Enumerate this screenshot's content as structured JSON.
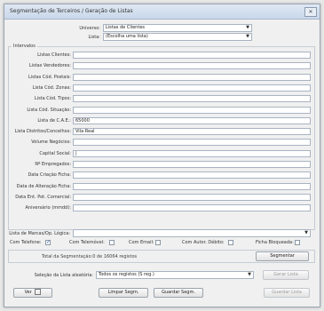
{
  "window": {
    "title": "Segmentação de Terceiros / Geração de Listas"
  },
  "top": {
    "universo_label": "Universo:",
    "universo_value": "Listas de Clientes",
    "lista_label": "Lista:",
    "lista_value": "(Escolha uma lista)"
  },
  "group": {
    "legend": "Intervalos"
  },
  "fields": [
    {
      "label": "Listas Clientes:",
      "value": ""
    },
    {
      "label": "Listas Vendedores:",
      "value": ""
    },
    {
      "label": "Listas Cód. Postais:",
      "value": ""
    },
    {
      "label": "Lista Cód. Zonas:",
      "value": ""
    },
    {
      "label": "Lista Cód. Tipos:",
      "value": ""
    },
    {
      "label": "Lista Cód. Situação:",
      "value": ""
    },
    {
      "label": "Lista de C.A.E.:",
      "value": "65000"
    },
    {
      "label": "Lista Distritos/Concelhos:",
      "value": "Vila Real"
    },
    {
      "label": "Volume Negócios:",
      "value": ""
    },
    {
      "label": "Capital Social:",
      "value": "|"
    },
    {
      "label": "Nº Empregados:",
      "value": ""
    },
    {
      "label": "Data Criação Ficha:",
      "value": ""
    },
    {
      "label": "Data de Alteração Ficha:",
      "value": ""
    },
    {
      "label": "Data Ent. Pot. Comercial:",
      "value": ""
    },
    {
      "label": "Aniversário (mmdd):",
      "value": ""
    }
  ],
  "marcas": {
    "label": "Lista de Marcas/Op. Lógica:",
    "value": ""
  },
  "checkboxes": [
    {
      "label": "Com Telefone:",
      "checked": true
    },
    {
      "label": "Com Telemóvel:",
      "checked": false
    },
    {
      "label": "Com Email:",
      "checked": false
    },
    {
      "label": "Com Autor. Débito:",
      "checked": false
    },
    {
      "label": "Ficha Bloqueada:",
      "checked": false
    }
  ],
  "result": {
    "text": "Total da Segmentação:0 de 16064 registos",
    "segmentar_label": "Segmentar"
  },
  "selection": {
    "label": "Seleção da Lista aleatória:",
    "value": "Todos os registos (S reg.)",
    "gerar_label": "Gerar Lista"
  },
  "footer": {
    "ver_label": "Ver",
    "limpar_label": "Limpar Segm.",
    "guardar_label": "Guardar Segm.",
    "guardar_lista_label": "Guardar Lista"
  }
}
